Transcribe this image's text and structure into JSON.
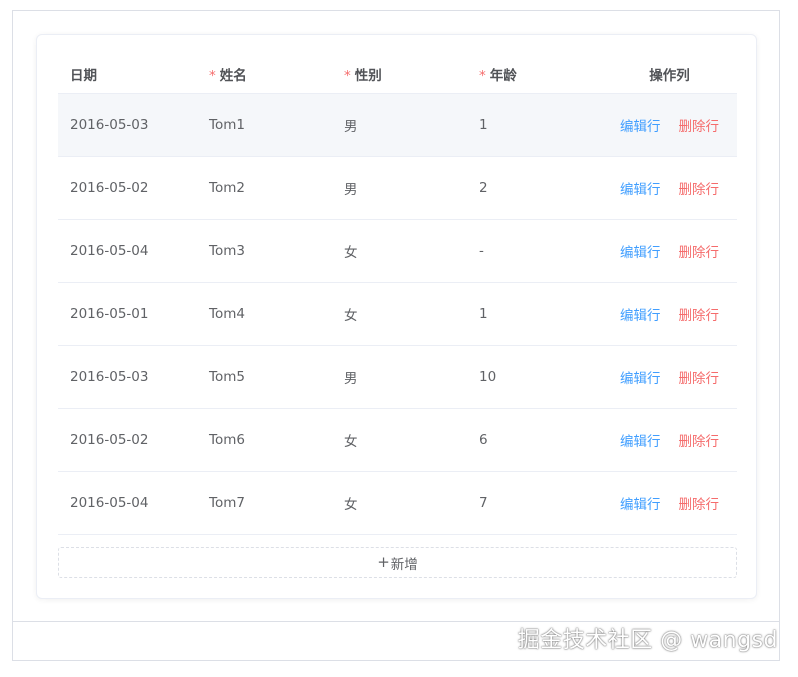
{
  "table": {
    "headers": {
      "date": "日期",
      "name": "姓名",
      "gender": "性别",
      "age": "年龄",
      "ops": "操作列",
      "required_mark": "*"
    },
    "rows": [
      {
        "date": "2016-05-03",
        "name": "Tom1",
        "gender": "男",
        "age": "1"
      },
      {
        "date": "2016-05-02",
        "name": "Tom2",
        "gender": "男",
        "age": "2"
      },
      {
        "date": "2016-05-04",
        "name": "Tom3",
        "gender": "女",
        "age": "-"
      },
      {
        "date": "2016-05-01",
        "name": "Tom4",
        "gender": "女",
        "age": "1"
      },
      {
        "date": "2016-05-03",
        "name": "Tom5",
        "gender": "男",
        "age": "10"
      },
      {
        "date": "2016-05-02",
        "name": "Tom6",
        "gender": "女",
        "age": "6"
      },
      {
        "date": "2016-05-04",
        "name": "Tom7",
        "gender": "女",
        "age": "7"
      }
    ],
    "edit_label": "编辑行",
    "delete_label": "删除行"
  },
  "add_button": {
    "icon": "+",
    "label": "新增"
  },
  "watermark": "掘金技术社区 @ wangsd",
  "colors": {
    "primary": "#409eff",
    "danger": "#f56c6c",
    "text": "#606266",
    "border": "#ebeef5"
  }
}
